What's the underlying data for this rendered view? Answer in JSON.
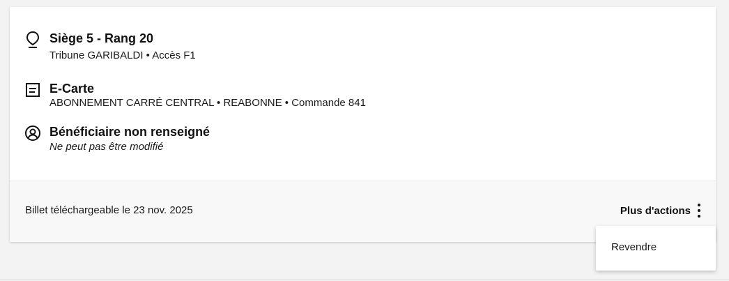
{
  "seat": {
    "icon": "location-pin-icon",
    "title": "Siège 5 - Rang 20",
    "subtitle": "Tribune GARIBALDI • Accès F1"
  },
  "ticket_type": {
    "icon": "document-icon",
    "title": "E-Carte",
    "subtitle": "ABONNEMENT CARRÉ CENTRAL • REABONNE • Commande 841"
  },
  "beneficiary": {
    "icon": "user-circle-icon",
    "title": "Bénéficiaire non renseigné",
    "subtitle": "Ne peut pas être modifié"
  },
  "footer": {
    "download_text": "Billet téléchargeable le 23 nov. 2025",
    "more_actions_label": "Plus d'actions",
    "more_actions_icon": "kebab-menu-icon"
  },
  "dropdown": {
    "items": [
      {
        "label": "Revendre"
      }
    ]
  }
}
